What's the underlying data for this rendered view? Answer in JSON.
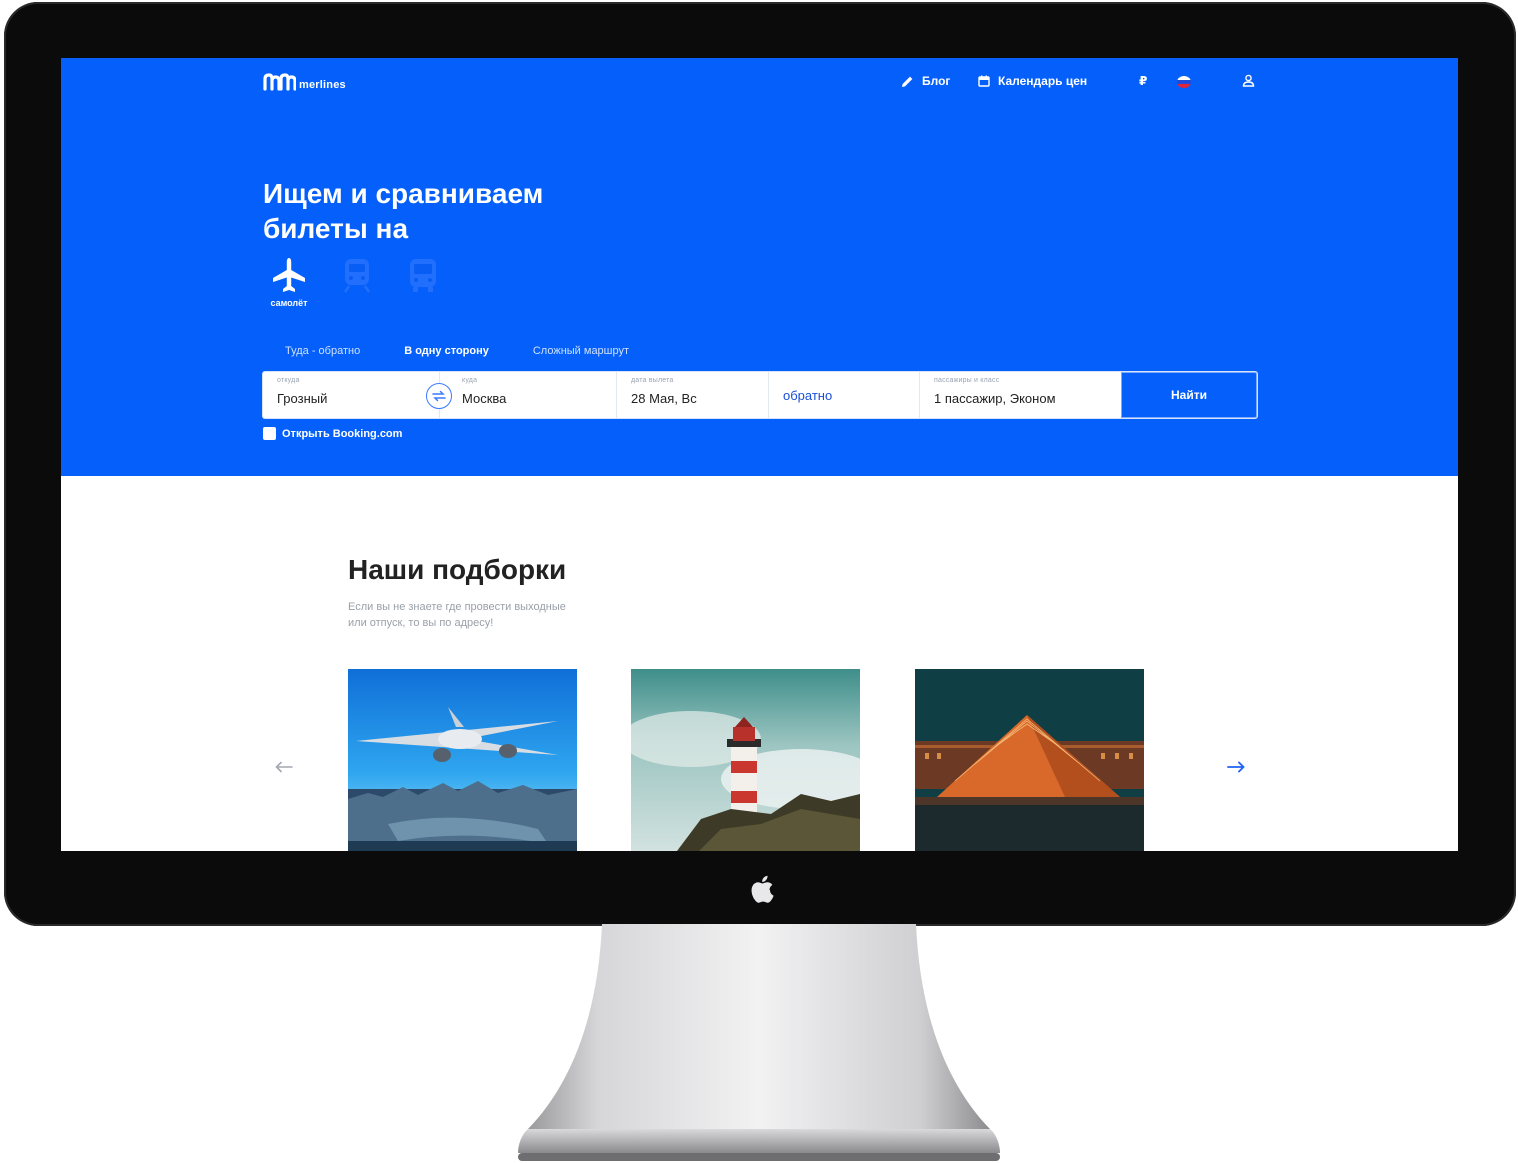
{
  "brand": {
    "name": "merlines"
  },
  "nav": {
    "blog": "Блог",
    "calendar": "Календарь цен",
    "currency": "₽"
  },
  "hero": {
    "title_line1": "Ищем и сравниваем",
    "title_line2": "билеты на"
  },
  "transport": {
    "plane_label": "самолёт"
  },
  "trip_tabs": {
    "round": "Туда - обратно",
    "oneway": "В одну сторону",
    "complex": "Сложный маршрут",
    "active": "oneway"
  },
  "search": {
    "from_label": "откуда",
    "from_value": "Грозный",
    "to_label": "куда",
    "to_value": "Москва",
    "date_label": "дата вылета",
    "date_value": "28 Мая, Вс",
    "return_value": "обратно",
    "pass_label": "пассажиры и класс",
    "pass_value": "1 пассажир, Эконом",
    "submit": "Найти"
  },
  "booking": {
    "label": "Открыть Booking.com",
    "checked": false
  },
  "collections": {
    "title": "Наши подборки",
    "subtitle_line1": "Если вы не знаете где провести выходные",
    "subtitle_line2": "или отпуск, то вы по адресу!"
  },
  "colors": {
    "brand_blue": "#0560fb",
    "frame": "#0b0b0c",
    "title_text": "#222222"
  },
  "icons": [
    "pencil-icon",
    "calendar-icon",
    "user-icon",
    "plane-icon",
    "train-icon",
    "bus-icon",
    "swap-icon",
    "arrow-left-icon",
    "arrow-right-icon",
    "apple-logo"
  ]
}
